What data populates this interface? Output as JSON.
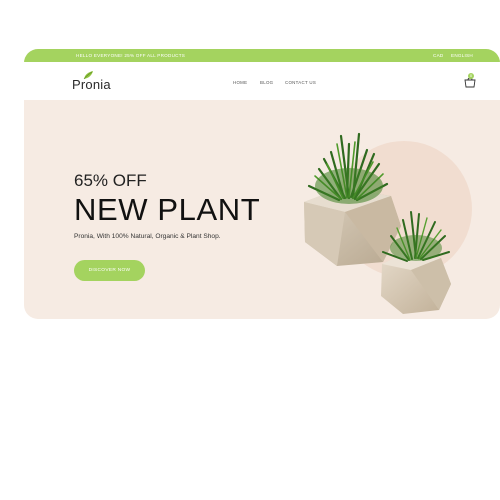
{
  "topbar": {
    "promo": "HELLO EVERYONE! 25% OFF ALL PRODUCTS",
    "currency": "CAD",
    "language": "ENGLISH"
  },
  "header": {
    "logo": "Pronia",
    "nav": [
      "HOME",
      "BLOG",
      "CONTACT US"
    ],
    "cart_icon": "shopping-bag-icon",
    "cart_count": "0"
  },
  "hero": {
    "subtitle": "65% OFF",
    "title": "NEW PLANT",
    "description": "Pronia, With 100% Natural, Organic & Plant Shop.",
    "button": "DISCOVER NOW"
  },
  "colors": {
    "accent": "#a4d35f",
    "hero_bg": "#f6ebe3",
    "circle": "#f1ddd0",
    "text": "#111111"
  }
}
